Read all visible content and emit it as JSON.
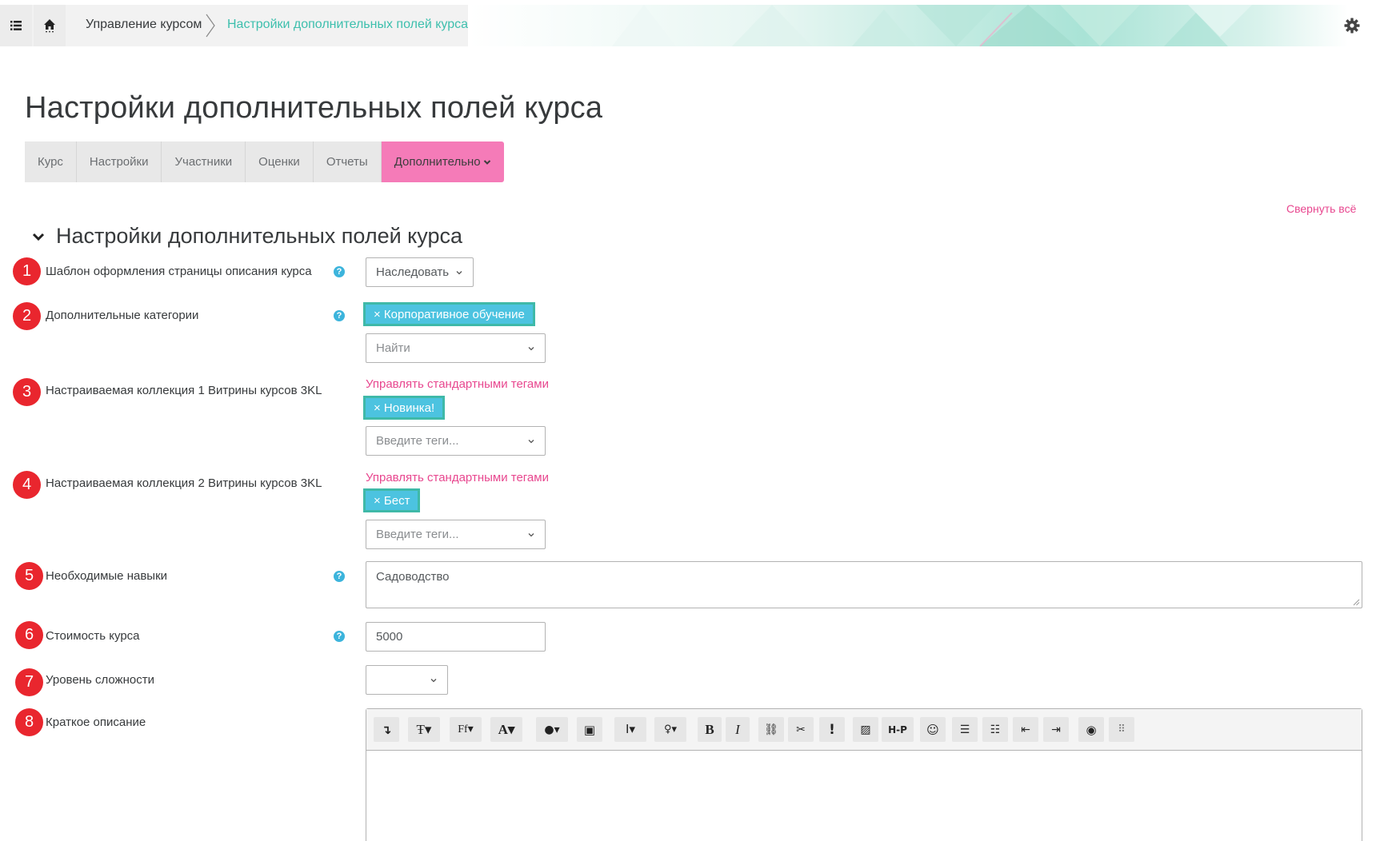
{
  "breadcrumb": {
    "items": [
      "Управление курсом",
      "Настройки дополнительных полей курса"
    ]
  },
  "page_title": "Настройки дополнительных полей курса",
  "tabs": [
    {
      "label": "Курс"
    },
    {
      "label": "Настройки"
    },
    {
      "label": "Участники"
    },
    {
      "label": "Оценки"
    },
    {
      "label": "Отчеты"
    },
    {
      "label": "Дополнительно"
    }
  ],
  "collapse_all": "Свернуть всё",
  "section_title": "Настройки дополнительных полей курса",
  "fields": {
    "f1": {
      "num": "1",
      "label": "Шаблон оформления страницы описания курса",
      "value": "Наследовать"
    },
    "f2": {
      "num": "2",
      "label": "Дополнительные категории",
      "tag": "× Корпоративное обучение",
      "placeholder": "Найти"
    },
    "f3": {
      "num": "3",
      "label": "Настраиваемая коллекция 1 Витрины курсов 3KL",
      "manage": "Управлять стандартными тегами",
      "tag": "× Новинка!",
      "placeholder": "Введите теги..."
    },
    "f4": {
      "num": "4",
      "label": "Настраиваемая коллекция 2 Витрины курсов 3KL",
      "manage": "Управлять стандартными тегами",
      "tag": "× Бест",
      "placeholder": "Введите теги..."
    },
    "f5": {
      "num": "5",
      "label": "Необходимые навыки",
      "value": "Садоводство"
    },
    "f6": {
      "num": "6",
      "label": "Стоимость курса",
      "value": "5000"
    },
    "f7": {
      "num": "7",
      "label": "Уровень сложности",
      "value": ""
    },
    "f8": {
      "num": "8",
      "label": "Краткое описание"
    }
  },
  "colors": {
    "accent_pink": "#e8478f",
    "tab_active": "#f57bb8",
    "tag_bg": "#4cc3e0",
    "tag_border": "#3fb9a8",
    "badge": "#e9262e",
    "help": "#3cb4dc",
    "breadcrumb_active": "#3dbfad"
  },
  "icons": [
    "list-icon",
    "home-icon",
    "gear-icon",
    "chevron-down-icon",
    "help-icon"
  ]
}
